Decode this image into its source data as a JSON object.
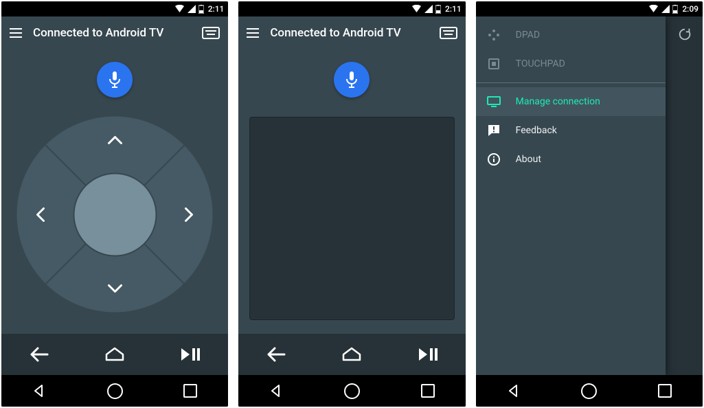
{
  "status": {
    "time_a": "2:11",
    "time_b": "2:11",
    "time_c": "2:09"
  },
  "appbar": {
    "title": "Connected to Android TV"
  },
  "drawer": {
    "dpad": "DPAD",
    "touchpad": "TOUCHPAD",
    "manage": "Manage connection",
    "feedback": "Feedback",
    "about": "About"
  },
  "colors": {
    "accent": "#1de9b6",
    "mic": "#2a74f0",
    "bg_dark": "#263238",
    "bg_mid": "#37474f",
    "dpad_outer": "#455a64",
    "dpad_center": "#78909c"
  }
}
